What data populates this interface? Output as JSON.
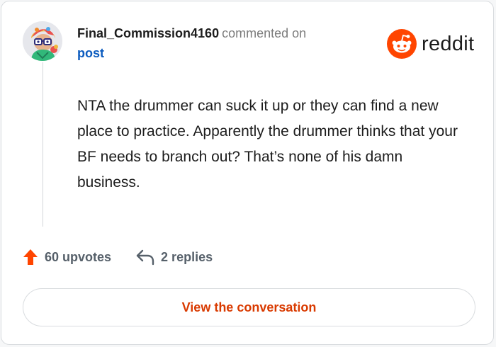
{
  "comment": {
    "author": "Final_Commission4160",
    "action_text": "commented on",
    "target_link": "post",
    "body": "NTA the drummer can suck it up or they can find a new place to practice. Apparently the drummer thinks that your BF needs to branch out? That’s none of his damn business."
  },
  "brand": {
    "name": "reddit",
    "accent_color": "#FF4500"
  },
  "stats": {
    "upvotes": "60 upvotes",
    "replies": "2 replies"
  },
  "footer": {
    "button_label": "View the conversation"
  },
  "icons": [
    "user-avatar",
    "reddit-snoo-icon",
    "upvote-arrow-icon",
    "reply-arrow-icon"
  ],
  "colors": {
    "link": "#0B5BBF",
    "upvote": "#FF4500",
    "button_text": "#D93A00",
    "muted_text": "#56606A"
  }
}
